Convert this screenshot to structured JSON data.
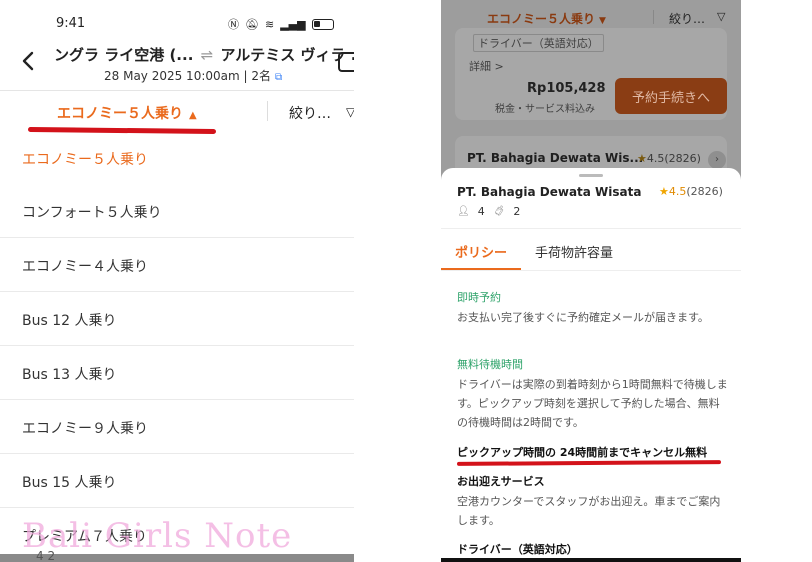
{
  "left": {
    "status": {
      "time": "9:41",
      "signal": "Ÿ́ .ıll"
    },
    "header": {
      "title_from": "ングラ ライ空港 (...",
      "title_arrow": "⇌",
      "title_to": "アルテミス ヴィラ ...",
      "subtitle": "28 May 2025 10:00am | 2名",
      "edit_icon": "edit-icon"
    },
    "filter": {
      "selected": "エコノミー５人乗り",
      "refine": "絞り…"
    },
    "menu": [
      {
        "label": "エコノミー５人乗り",
        "active": true
      },
      {
        "label": "コンフォート５人乗り"
      },
      {
        "label": "エコノミー４人乗り"
      },
      {
        "label": "Bus 12 人乗り"
      },
      {
        "label": "Bus 13 人乗り"
      },
      {
        "label": "エコノミー９人乗り"
      },
      {
        "label": "Bus 15 人乗り"
      },
      {
        "label": "プレミアム７人乗り"
      }
    ],
    "bottom_meta": "4   2",
    "watermark": "Bali Girls Note",
    "colors": {
      "accent": "#ea6a1d",
      "annotation": "#d3121a"
    }
  },
  "right": {
    "topbar": {
      "selected": "エコノミー５人乗り",
      "refine": "絞り…"
    },
    "card1": {
      "driver_tag": "ドライバー（英語対応）",
      "detail": "詳細 >",
      "price": "Rp105,428",
      "tax_note": "税金・サービス料込み",
      "book_label": "予約手続きへ"
    },
    "card2": {
      "name": "PT. Bahagia Dewata Wis...",
      "rating": "4.5",
      "reviews": "(2826)"
    },
    "sheet": {
      "name": "PT. Bahagia Dewata Wisata",
      "rating": "4.5",
      "reviews": "(2826)",
      "passengers": "4",
      "luggage": "2",
      "tabs": [
        "ポリシー",
        "手荷物許容量"
      ],
      "policies": [
        {
          "heading": "即時予約",
          "body": "お支払い完了後すぐに予約確定メールが届きます。"
        },
        {
          "heading": "無料待機時間",
          "body": "ドライバーは実際の到着時刻から1時間無料で待機します。ピックアップ時刻を選択して予約した場合、無料の待機時間は2時間です。"
        }
      ],
      "cancel_note": "ピックアップ時間の 24時間前までキャンセル無料",
      "pickup_heading": "お出迎えサービス",
      "pickup_body": "空港カウンターでスタッフがお出迎え。車までご案内します。",
      "driver_heading": "ドライバー（英語対応）"
    }
  }
}
